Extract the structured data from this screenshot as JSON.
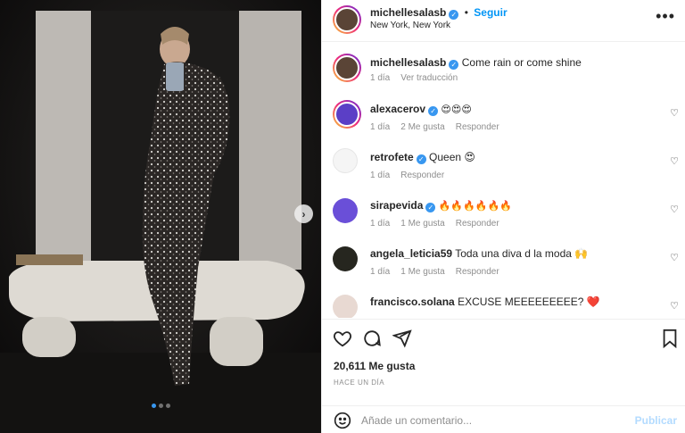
{
  "post": {
    "author": "michellesalasb",
    "follow_label": "Seguir",
    "location": "New York, New York",
    "more_label": "•••",
    "caption_author": "michellesalasb",
    "caption": "Come rain or come shine",
    "caption_time": "1 día",
    "caption_translate": "Ver traducción",
    "likes": "20,611 Me gusta",
    "posted": "HACE UN DÍA"
  },
  "comments": [
    {
      "user": "alexacerov",
      "verified": true,
      "text": "😍😍😍",
      "time": "1 día",
      "likes": "2 Me gusta",
      "reply": "Responder",
      "avatar_color": "#5b3fc6"
    },
    {
      "user": "retrofete",
      "verified": true,
      "text": "Queen 😍",
      "time": "1 día",
      "likes": "",
      "reply": "Responder",
      "avatar_color": "#f5f5f5"
    },
    {
      "user": "sirapevida",
      "verified": true,
      "text": "🔥🔥🔥🔥🔥🔥",
      "time": "1 día",
      "likes": "1 Me gusta",
      "reply": "Responder",
      "avatar_color": "#6a4fd8"
    },
    {
      "user": "angela_leticia59",
      "verified": false,
      "text": "Toda una diva d la moda 🙌",
      "time": "1 día",
      "likes": "1 Me gusta",
      "reply": "Responder",
      "avatar_color": "#26261f"
    },
    {
      "user": "francisco.solana",
      "verified": false,
      "text": "EXCUSE MEEEEEEEEE? ❤️",
      "time": "",
      "likes": "",
      "reply": "",
      "avatar_color": "#e8d9d2"
    }
  ],
  "add_comment": {
    "placeholder": "Añade un comentario...",
    "publish_label": "Publicar"
  },
  "icons": [
    "heart-icon",
    "comment-icon",
    "share-icon",
    "bookmark-icon",
    "emoji-icon",
    "chevron-right-icon",
    "more-icon"
  ],
  "colors": {
    "accent": "#0095f6",
    "verified": "#3897f0",
    "muted": "#8e8e8e"
  },
  "carousel": {
    "slides": 3,
    "active": 1
  }
}
